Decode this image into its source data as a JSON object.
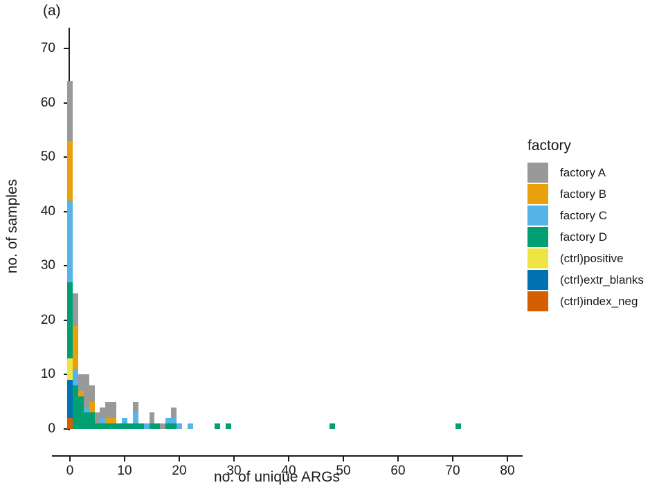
{
  "panel": {
    "label": "(a)"
  },
  "legend": {
    "title": "factory",
    "items": [
      {
        "label": "factory A",
        "color": "#999999"
      },
      {
        "label": "factory B",
        "color": "#E8A00D"
      },
      {
        "label": "factory C",
        "color": "#56B4E9"
      },
      {
        "label": "factory D",
        "color": "#00A073"
      },
      {
        "label": "(ctrl)positive",
        "color": "#F0E442"
      },
      {
        "label": "(ctrl)extr_blanks",
        "color": "#0072B2"
      },
      {
        "label": "(ctrl)index_neg",
        "color": "#D55E00"
      }
    ]
  },
  "chart_data": {
    "type": "bar",
    "subtype": "stacked-histogram",
    "title": "(a)",
    "xlabel": "no. of unique ARGs",
    "ylabel": "no. of samples",
    "xlim": [
      -3,
      85
    ],
    "ylim": [
      0,
      74
    ],
    "xticks": [
      0,
      10,
      20,
      30,
      40,
      50,
      60,
      70,
      80
    ],
    "yticks": [
      0,
      10,
      20,
      30,
      40,
      50,
      60,
      70
    ],
    "grid": false,
    "legend_position": "right",
    "bin_width": 1,
    "series_order": [
      "(ctrl)index_neg",
      "(ctrl)extr_blanks",
      "(ctrl)positive",
      "factory D",
      "factory C",
      "factory B",
      "factory A"
    ],
    "series_colors": {
      "factory A": "#999999",
      "factory B": "#E8A00D",
      "factory C": "#56B4E9",
      "factory D": "#00A073",
      "(ctrl)positive": "#F0E442",
      "(ctrl)extr_blanks": "#0072B2",
      "(ctrl)index_neg": "#D55E00"
    },
    "bins": [
      {
        "x": 0,
        "total": 64,
        "segments": [
          {
            "name": "(ctrl)index_neg",
            "value": 2
          },
          {
            "name": "(ctrl)extr_blanks",
            "value": 7
          },
          {
            "name": "(ctrl)positive",
            "value": 4
          },
          {
            "name": "factory D",
            "value": 14
          },
          {
            "name": "factory C",
            "value": 15
          },
          {
            "name": "factory B",
            "value": 11
          },
          {
            "name": "factory A",
            "value": 11
          }
        ]
      },
      {
        "x": 1,
        "total": 25,
        "segments": [
          {
            "name": "factory D",
            "value": 8
          },
          {
            "name": "factory C",
            "value": 3
          },
          {
            "name": "factory B",
            "value": 8
          },
          {
            "name": "factory A",
            "value": 6
          }
        ]
      },
      {
        "x": 2,
        "total": 10,
        "segments": [
          {
            "name": "factory D",
            "value": 6
          },
          {
            "name": "factory B",
            "value": 1
          },
          {
            "name": "factory A",
            "value": 3
          }
        ]
      },
      {
        "x": 3,
        "total": 10,
        "segments": [
          {
            "name": "factory D",
            "value": 3
          },
          {
            "name": "factory C",
            "value": 1
          },
          {
            "name": "factory A",
            "value": 6
          }
        ]
      },
      {
        "x": 4,
        "total": 8,
        "segments": [
          {
            "name": "factory D",
            "value": 3
          },
          {
            "name": "factory B",
            "value": 2
          },
          {
            "name": "factory A",
            "value": 3
          }
        ]
      },
      {
        "x": 5,
        "total": 3,
        "segments": [
          {
            "name": "factory D",
            "value": 1
          },
          {
            "name": "factory A",
            "value": 2
          }
        ]
      },
      {
        "x": 6,
        "total": 4,
        "segments": [
          {
            "name": "factory D",
            "value": 1
          },
          {
            "name": "factory C",
            "value": 1
          },
          {
            "name": "factory A",
            "value": 2
          }
        ]
      },
      {
        "x": 7,
        "total": 5,
        "segments": [
          {
            "name": "factory D",
            "value": 1
          },
          {
            "name": "factory B",
            "value": 1
          },
          {
            "name": "factory A",
            "value": 3
          }
        ]
      },
      {
        "x": 8,
        "total": 5,
        "segments": [
          {
            "name": "factory D",
            "value": 1
          },
          {
            "name": "factory B",
            "value": 1
          },
          {
            "name": "factory A",
            "value": 3
          }
        ]
      },
      {
        "x": 9,
        "total": 1,
        "segments": [
          {
            "name": "factory D",
            "value": 1
          }
        ]
      },
      {
        "x": 10,
        "total": 2,
        "segments": [
          {
            "name": "factory D",
            "value": 1
          },
          {
            "name": "factory C",
            "value": 1
          }
        ]
      },
      {
        "x": 11,
        "total": 1,
        "segments": [
          {
            "name": "factory D",
            "value": 1
          }
        ]
      },
      {
        "x": 12,
        "total": 5,
        "segments": [
          {
            "name": "factory D",
            "value": 1
          },
          {
            "name": "factory C",
            "value": 2
          },
          {
            "name": "factory A",
            "value": 2
          }
        ]
      },
      {
        "x": 13,
        "total": 1,
        "segments": [
          {
            "name": "factory D",
            "value": 1
          }
        ]
      },
      {
        "x": 14,
        "total": 1,
        "segments": [
          {
            "name": "factory C",
            "value": 1
          }
        ]
      },
      {
        "x": 15,
        "total": 3,
        "segments": [
          {
            "name": "factory D",
            "value": 1
          },
          {
            "name": "factory A",
            "value": 2
          }
        ]
      },
      {
        "x": 16,
        "total": 1,
        "segments": [
          {
            "name": "factory D",
            "value": 1
          }
        ]
      },
      {
        "x": 17,
        "total": 1,
        "segments": [
          {
            "name": "factory A",
            "value": 1
          }
        ]
      },
      {
        "x": 18,
        "total": 2,
        "segments": [
          {
            "name": "factory D",
            "value": 1
          },
          {
            "name": "factory C",
            "value": 1
          }
        ]
      },
      {
        "x": 19,
        "total": 4,
        "segments": [
          {
            "name": "factory D",
            "value": 1
          },
          {
            "name": "factory C",
            "value": 1
          },
          {
            "name": "factory A",
            "value": 2
          }
        ]
      },
      {
        "x": 20,
        "total": 1,
        "segments": [
          {
            "name": "factory C",
            "value": 1
          }
        ]
      },
      {
        "x": 22,
        "total": 1,
        "segments": [
          {
            "name": "factory C",
            "value": 1
          }
        ]
      },
      {
        "x": 27,
        "total": 1,
        "segments": [
          {
            "name": "factory D",
            "value": 1
          }
        ]
      },
      {
        "x": 29,
        "total": 1,
        "segments": [
          {
            "name": "factory D",
            "value": 1
          }
        ]
      },
      {
        "x": 48,
        "total": 1,
        "segments": [
          {
            "name": "factory D",
            "value": 1
          }
        ]
      },
      {
        "x": 71,
        "total": 1,
        "segments": [
          {
            "name": "factory D",
            "value": 1
          }
        ]
      }
    ]
  }
}
